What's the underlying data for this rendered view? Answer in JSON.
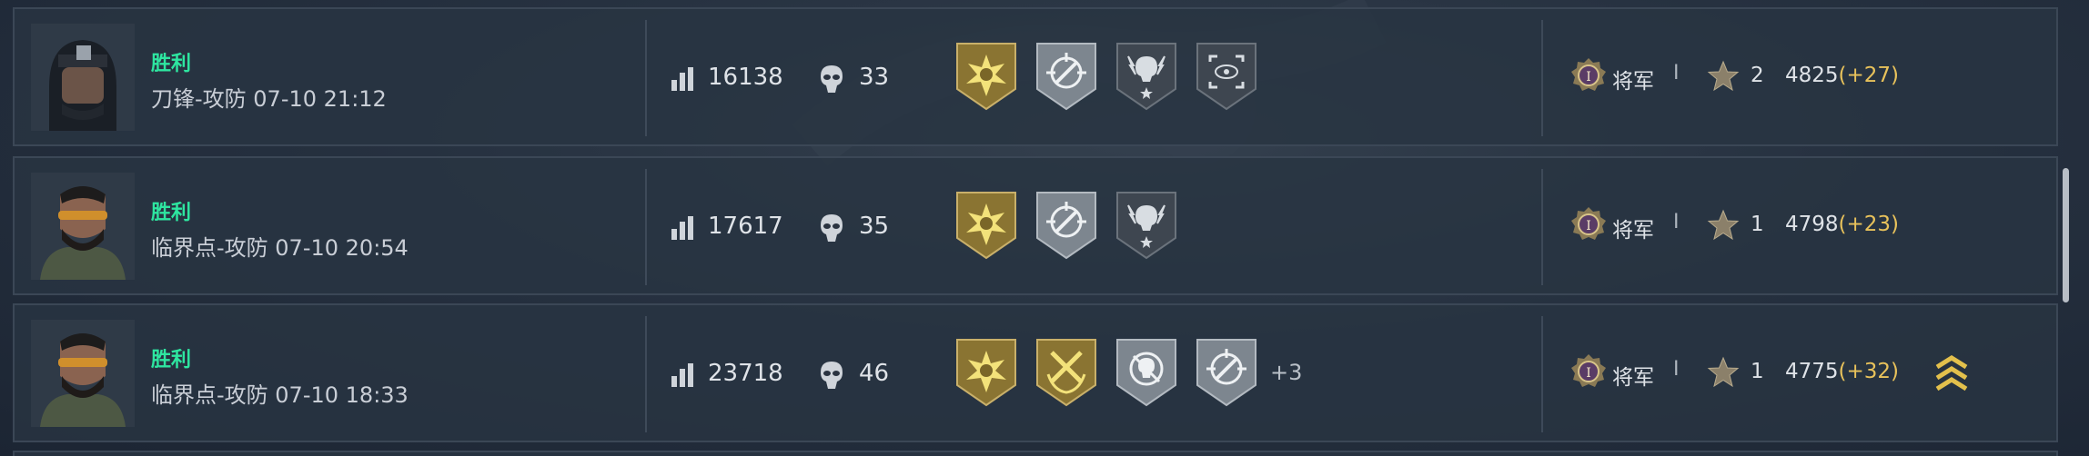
{
  "matches": [
    {
      "result": "胜利",
      "mode_time": "刀锋-攻防 07-10 21:12",
      "score": "16138",
      "kills": "33",
      "medals": [
        "gold-sunburst-medal",
        "silver-crosshair-rifle-medal",
        "dark-skull-lightning-medal",
        "dark-eye-target-medal"
      ],
      "more_medals": "",
      "rank": "将军",
      "rank_separator": "I",
      "level": "2",
      "points": "4825",
      "delta": "(+27)",
      "promotion": false
    },
    {
      "result": "胜利",
      "mode_time": "临界点-攻防 07-10 20:54",
      "score": "17617",
      "kills": "35",
      "medals": [
        "gold-sunburst-medal",
        "silver-crosshair-rifle-medal",
        "dark-skull-lightning-medal"
      ],
      "more_medals": "",
      "rank": "将军",
      "rank_separator": "I",
      "level": "1",
      "points": "4798",
      "delta": "(+23)",
      "promotion": false
    },
    {
      "result": "胜利",
      "mode_time": "临界点-攻防 07-10 18:33",
      "score": "23718",
      "kills": "46",
      "medals": [
        "gold-sunburst-medal",
        "gold-wrench-laurel-medal",
        "silver-skull-crosshair-medal",
        "silver-crosshair-rifle-medal"
      ],
      "more_medals": "+3",
      "rank": "将军",
      "rank_separator": "I",
      "level": "1",
      "points": "4775",
      "delta": "(+32)",
      "promotion": true
    }
  ],
  "colors": {
    "victory": "#2ee6a0",
    "delta": "#e8c25b",
    "gold_medal": "#8a7432",
    "silver_medal": "#8c949c",
    "dark_medal": "#3e4650"
  }
}
